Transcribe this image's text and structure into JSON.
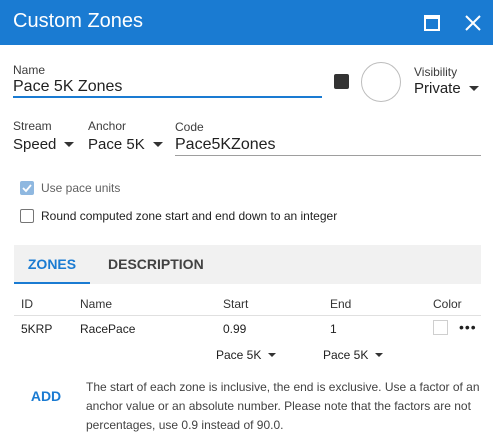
{
  "window": {
    "title": "Custom Zones",
    "maximize_icon": "maximize-icon",
    "close_icon": "close-icon"
  },
  "form": {
    "name": {
      "label": "Name",
      "value": "Pace 5K Zones"
    },
    "color_swatch": "#333333",
    "visibility": {
      "label": "Visibility",
      "value": "Private"
    },
    "stream": {
      "label": "Stream",
      "value": "Speed"
    },
    "anchor": {
      "label": "Anchor",
      "value": "Pace 5K"
    },
    "code": {
      "label": "Code",
      "value": "Pace5KZones"
    },
    "use_pace_units": {
      "label": "Use pace units",
      "checked": true
    },
    "round_down": {
      "label": "Round computed zone start and end down to an integer",
      "checked": false
    }
  },
  "tabs": [
    {
      "label": "ZONES",
      "active": true
    },
    {
      "label": "DESCRIPTION",
      "active": false
    }
  ],
  "table": {
    "headers": [
      "ID",
      "Name",
      "Start",
      "End",
      "Color"
    ],
    "rows": [
      {
        "id": "5KRP",
        "name": "RacePace",
        "start": "0.99",
        "end": "1",
        "start_unit": "Pace 5K",
        "end_unit": "Pace 5K",
        "menu": "•••"
      }
    ]
  },
  "footer": {
    "add_label": "ADD",
    "help": "The start of each zone is inclusive, the end is exclusive. Use a factor of an anchor value or an absolute number. Please note that the factors are not percentages, use 0.9 instead of 90.0."
  },
  "colors": {
    "accent": "#1a7bd2",
    "checkbox_checked": "#8fb8e0",
    "tab_bar": "#f1f1f1"
  }
}
